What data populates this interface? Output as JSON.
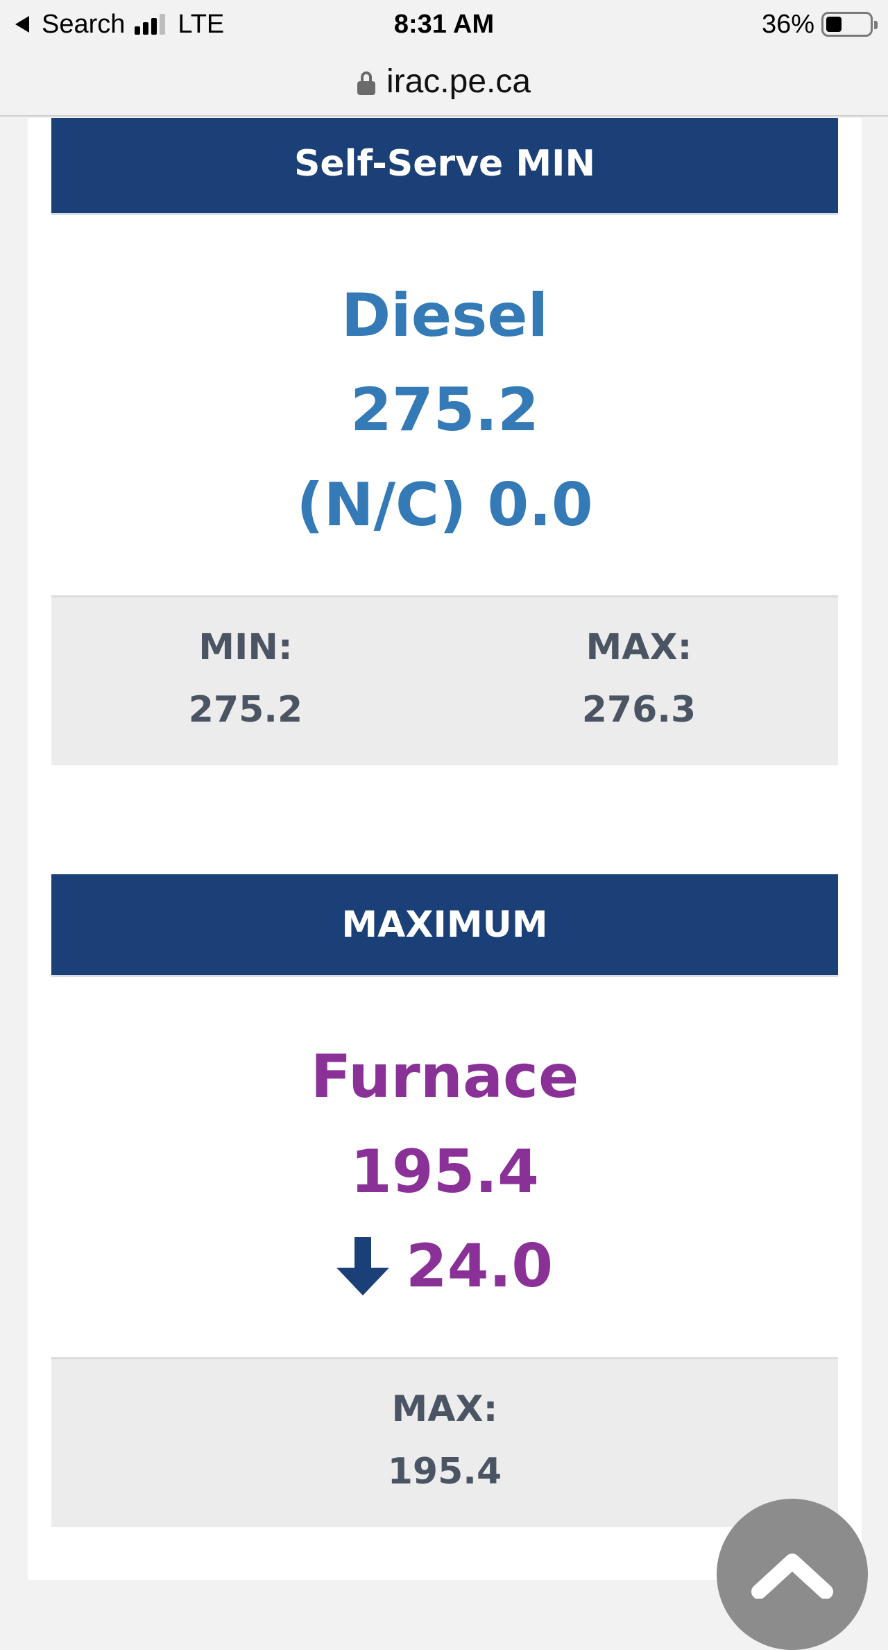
{
  "status_bar": {
    "back_label": "Search",
    "network": "LTE",
    "time": "8:31 AM",
    "battery": "36%",
    "battery_level": 0.36
  },
  "url_bar": {
    "domain": "irac.pe.ca"
  },
  "sections": [
    {
      "header": "Self-Serve MIN",
      "fuel": "Diesel",
      "price": "275.2",
      "change": "(N/C) 0.0",
      "fuel_color": "#337ab7",
      "stats": [
        {
          "label": "MIN:",
          "value": "275.2"
        },
        {
          "label": "MAX:",
          "value": "276.3"
        }
      ]
    },
    {
      "header": "MAXIMUM",
      "fuel": "Furnace",
      "price": "195.4",
      "change": "24.0",
      "change_icon": "down-arrow-icon",
      "fuel_color": "#8a3197",
      "stats": [
        {
          "label": "MAX:",
          "value": "195.4"
        }
      ]
    }
  ],
  "colors": {
    "header_bg": "#1b3f77",
    "stats_bg": "#ececec",
    "stats_text": "#4a5463",
    "arrow": "#1b3f77",
    "scroll_button": "#8c8c8c"
  },
  "scroll_top_icon": "chevron-up-icon"
}
